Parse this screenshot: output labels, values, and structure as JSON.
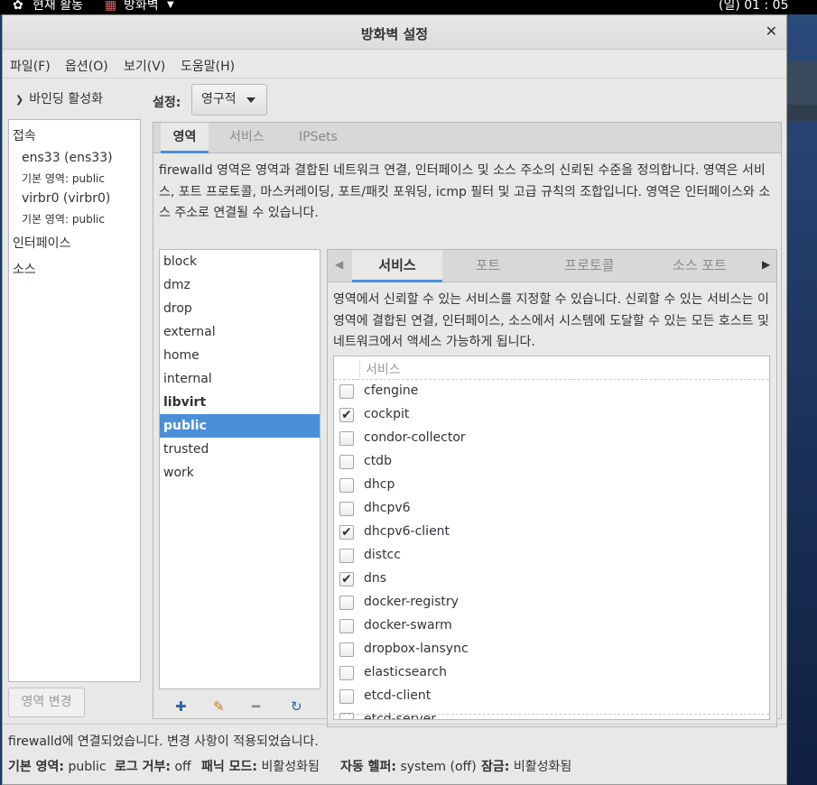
{
  "topbar": {
    "activities": "현재 활동",
    "app_menu": "방화벽",
    "clock": "(일) 01 : 05"
  },
  "window": {
    "title": "방화벽 설정"
  },
  "menu": {
    "file": "파일(F)",
    "options": "옵션(O)",
    "view": "보기(V)",
    "help": "도움말(H)"
  },
  "left": {
    "binding_toggle": "바인딩 활성화",
    "connections_header": "접속",
    "connections": [
      {
        "name": "ens33 (ens33)",
        "zone_label": "기본 영역:",
        "zone": "public"
      },
      {
        "name": "virbr0 (virbr0)",
        "zone_label": "기본 영역:",
        "zone": "public"
      }
    ],
    "interfaces_header": "인터페이스",
    "sources_header": "소스",
    "change_zone_button": "영역 변경"
  },
  "config": {
    "label": "설정:",
    "value": "영구적"
  },
  "tabs": [
    "영역",
    "서비스",
    "IPSets"
  ],
  "zone_description": "firewalld 영역은 영역과 결합된 네트워크 연결, 인터페이스 및 소스 주소의 신뢰된 수준을 정의합니다. 영역은 서비스, 포트 프로토콜, 마스커레이딩, 포트/패킷 포워딩, icmp 필터 및 고급 규칙의 조합입니다. 영역은 인터페이스와 소스 주소로 연결될 수 있습니다.",
  "zones": [
    "block",
    "dmz",
    "drop",
    "external",
    "home",
    "internal",
    "libvirt",
    "public",
    "trusted",
    "work"
  ],
  "selected_zone": "public",
  "inner_tabs": [
    "서비스",
    "포트",
    "프로토콜",
    "소스 포트"
  ],
  "service_description": "영역에서 신뢰할 수 있는 서비스를 지정할 수 있습니다. 신뢰할 수 있는 서비스는 이 영역에 결합된 연결, 인터페이스, 소스에서 시스템에 도달할 수 있는 모든 호스트 및 네트워크에서 액세스 가능하게 됩니다.",
  "service_column": "서비스",
  "services": [
    {
      "name": "cfengine",
      "checked": false
    },
    {
      "name": "cockpit",
      "checked": true
    },
    {
      "name": "condor-collector",
      "checked": false
    },
    {
      "name": "ctdb",
      "checked": false
    },
    {
      "name": "dhcp",
      "checked": false
    },
    {
      "name": "dhcpv6",
      "checked": false
    },
    {
      "name": "dhcpv6-client",
      "checked": true
    },
    {
      "name": "distcc",
      "checked": false
    },
    {
      "name": "dns",
      "checked": true
    },
    {
      "name": "docker-registry",
      "checked": false
    },
    {
      "name": "docker-swarm",
      "checked": false
    },
    {
      "name": "dropbox-lansync",
      "checked": false
    },
    {
      "name": "elasticsearch",
      "checked": false
    },
    {
      "name": "etcd-client",
      "checked": false
    },
    {
      "name": "etcd-server",
      "checked": false
    }
  ],
  "status": {
    "message": "firewalld에 연결되었습니다. 변경 사항이 적용되었습니다.",
    "default_zone_label": "기본 영역:",
    "default_zone": "public",
    "log_denied_label": "로그 거부:",
    "log_denied": "off",
    "panic_label": "패닉 모드:",
    "panic": "비활성화됨",
    "helper_label": "자동 헬퍼:",
    "helper": "system (off)",
    "lockdown_label": "잠금:",
    "lockdown": "비활성화됨"
  },
  "colors": {
    "accent": "#4a90d9",
    "window_bg": "#e8e8e7"
  }
}
